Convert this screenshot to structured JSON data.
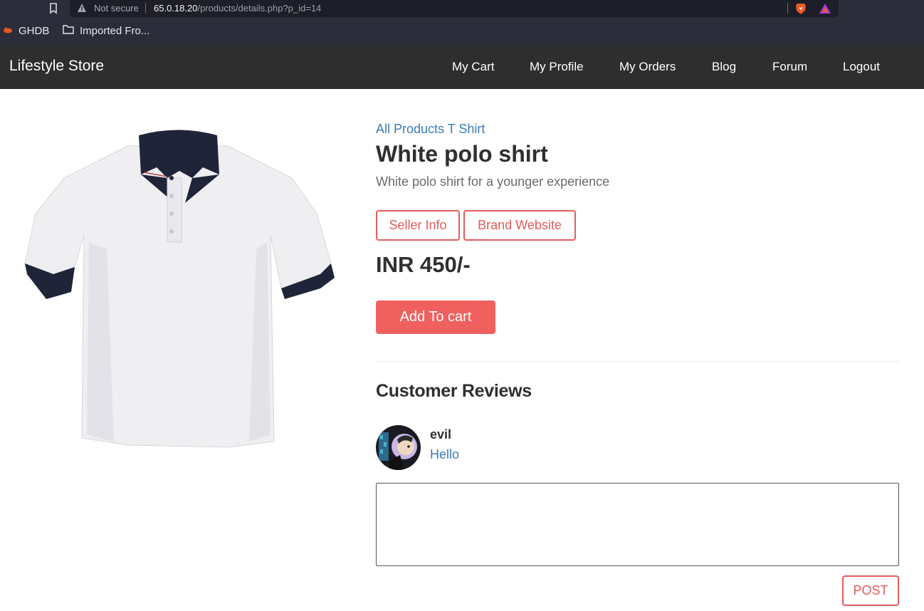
{
  "browser": {
    "not_secure": "Not secure",
    "url_host": "65.0.18.20",
    "url_path": "/products/details.php?p_id=14",
    "bookmarks": [
      {
        "label": "GHDB",
        "icon": "ghdb-icon"
      },
      {
        "label": "Imported Fro...",
        "icon": "folder-icon"
      }
    ]
  },
  "navbar": {
    "brand": "Lifestyle Store",
    "links": [
      "My Cart",
      "My Profile",
      "My Orders",
      "Blog",
      "Forum",
      "Logout"
    ]
  },
  "product": {
    "breadcrumb": "All Products T Shirt",
    "title": "White polo shirt",
    "description": "White polo shirt for a younger experience",
    "seller_info": "Seller Info",
    "brand_website": "Brand Website",
    "price": "INR 450/-",
    "add_to_cart": "Add To cart"
  },
  "reviews": {
    "heading": "Customer Reviews",
    "items": [
      {
        "user": "evil",
        "text": "Hello"
      }
    ],
    "post_label": "POST"
  },
  "colors": {
    "navbar_bg": "#2e2e2e",
    "accent": "#f0605f",
    "link_blue": "#3a7bb5"
  }
}
